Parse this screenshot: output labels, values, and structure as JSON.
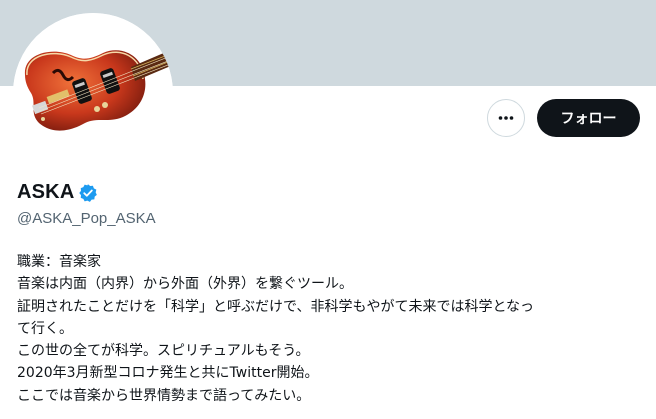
{
  "profile": {
    "name": "ASKA",
    "handle": "@ASKA_Pop_ASKA",
    "verified": true,
    "avatar_icon": "violin-bass-guitar-avatar",
    "bio_lines": [
      "職業：音楽家",
      "音楽は内面（内界）から外面（外界）を繋ぐツール。",
      "証明されたことだけを「科学」と呼ぶだけで、非科学もやがて未来では科学となっ",
      "て行く。",
      "この世の全てが科学。スピリチュアルもそう。",
      "2020年3月新型コロナ発生と共にTwitter開始。",
      "ここでは音楽から世界情勢まで語ってみたい。"
    ]
  },
  "actions": {
    "more_icon": "more-horizontal-icon",
    "follow_label": "フォロー"
  },
  "colors": {
    "banner": "#cfd9de",
    "follow_bg": "#0f1419",
    "verified": "#1d9bf0",
    "handle_text": "#536471"
  }
}
